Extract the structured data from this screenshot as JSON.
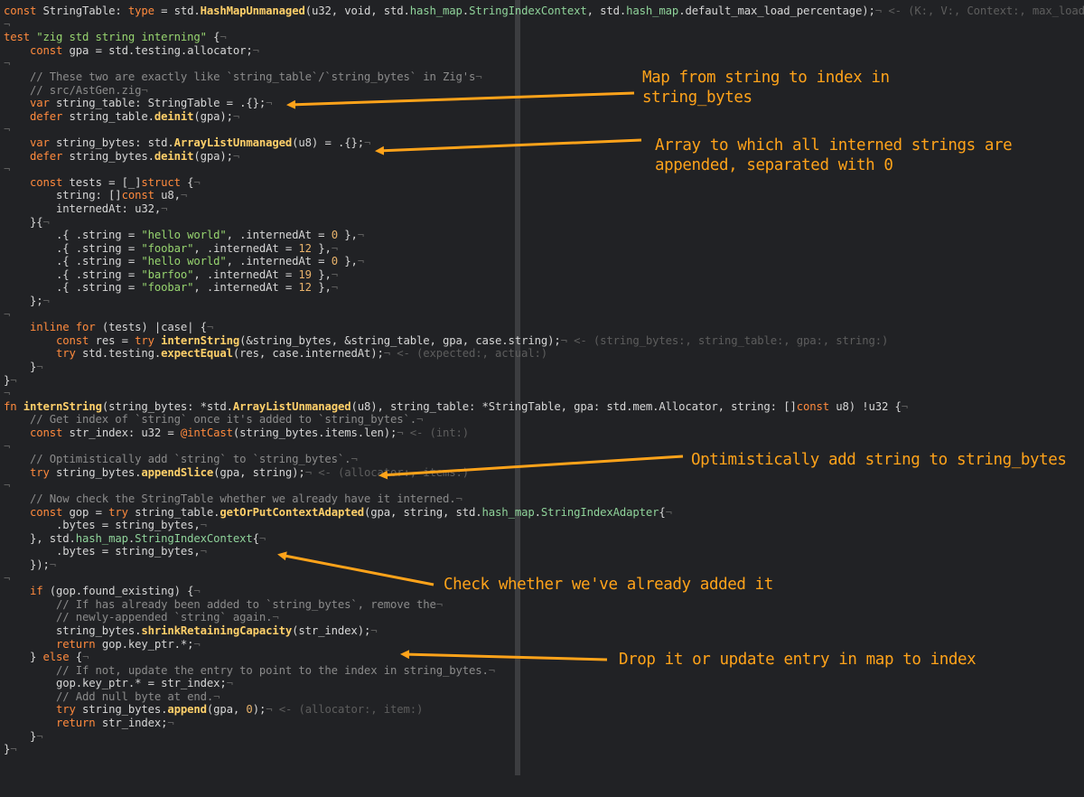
{
  "code_lines": [
    [
      [
        "kw",
        "const"
      ],
      [
        "p",
        " StringTable: "
      ],
      [
        "kw",
        "type"
      ],
      [
        "p",
        " = std."
      ],
      [
        "fn",
        "HashMapUnmanaged"
      ],
      [
        "p",
        "(u32, void, std."
      ],
      [
        "ty",
        "hash_map"
      ],
      [
        "p",
        "."
      ],
      [
        "ty",
        "StringIndexContext"
      ],
      [
        "p",
        ", std."
      ],
      [
        "ty",
        "hash_map"
      ],
      [
        "p",
        ".default_max_load_percentage);"
      ],
      [
        "pm",
        "¬"
      ],
      [
        "hint",
        " <- (K:, V:, Context:, max_load_p"
      ]
    ],
    [
      [
        "pm",
        "¬"
      ]
    ],
    [
      [
        "kw",
        "test"
      ],
      [
        "p",
        " "
      ],
      [
        "str",
        "\"zig std string interning\""
      ],
      [
        "p",
        " {"
      ],
      [
        "pm",
        "¬"
      ]
    ],
    [
      [
        "p",
        "    "
      ],
      [
        "kw",
        "const"
      ],
      [
        "p",
        " gpa = std.testing.allocator;"
      ],
      [
        "pm",
        "¬"
      ]
    ],
    [
      [
        "pm",
        "¬"
      ]
    ],
    [
      [
        "cm",
        "    // These two are exactly like `string_table`/`string_bytes` in Zig's"
      ],
      [
        "pm",
        "¬"
      ]
    ],
    [
      [
        "cm",
        "    // src/AstGen.zig"
      ],
      [
        "pm",
        "¬"
      ]
    ],
    [
      [
        "p",
        "    "
      ],
      [
        "kw",
        "var"
      ],
      [
        "p",
        " string_table: StringTable = .{};"
      ],
      [
        "pm",
        "¬"
      ]
    ],
    [
      [
        "p",
        "    "
      ],
      [
        "kw",
        "defer"
      ],
      [
        "p",
        " string_table."
      ],
      [
        "fn",
        "deinit"
      ],
      [
        "p",
        "(gpa);"
      ],
      [
        "pm",
        "¬"
      ]
    ],
    [
      [
        "pm",
        "¬"
      ]
    ],
    [
      [
        "p",
        "    "
      ],
      [
        "kw",
        "var"
      ],
      [
        "p",
        " string_bytes: std."
      ],
      [
        "fn",
        "ArrayListUnmanaged"
      ],
      [
        "p",
        "(u8) = .{};"
      ],
      [
        "pm",
        "¬"
      ]
    ],
    [
      [
        "p",
        "    "
      ],
      [
        "kw",
        "defer"
      ],
      [
        "p",
        " string_bytes."
      ],
      [
        "fn",
        "deinit"
      ],
      [
        "p",
        "(gpa);"
      ],
      [
        "pm",
        "¬"
      ]
    ],
    [
      [
        "pm",
        "¬"
      ]
    ],
    [
      [
        "p",
        "    "
      ],
      [
        "kw",
        "const"
      ],
      [
        "p",
        " tests = [_]"
      ],
      [
        "kw",
        "struct"
      ],
      [
        "p",
        " {"
      ],
      [
        "pm",
        "¬"
      ]
    ],
    [
      [
        "p",
        "        string: []"
      ],
      [
        "kw",
        "const"
      ],
      [
        "p",
        " u8,"
      ],
      [
        "pm",
        "¬"
      ]
    ],
    [
      [
        "p",
        "        internedAt: u32,"
      ],
      [
        "pm",
        "¬"
      ]
    ],
    [
      [
        "p",
        "    }{"
      ],
      [
        "pm",
        "¬"
      ]
    ],
    [
      [
        "p",
        "        .{ .string = "
      ],
      [
        "str",
        "\"hello world\""
      ],
      [
        "p",
        ", .internedAt = "
      ],
      [
        "num",
        "0"
      ],
      [
        "p",
        " },"
      ],
      [
        "pm",
        "¬"
      ]
    ],
    [
      [
        "p",
        "        .{ .string = "
      ],
      [
        "str",
        "\"foobar\""
      ],
      [
        "p",
        ", .internedAt = "
      ],
      [
        "num",
        "12"
      ],
      [
        "p",
        " },"
      ],
      [
        "pm",
        "¬"
      ]
    ],
    [
      [
        "p",
        "        .{ .string = "
      ],
      [
        "str",
        "\"hello world\""
      ],
      [
        "p",
        ", .internedAt = "
      ],
      [
        "num",
        "0"
      ],
      [
        "p",
        " },"
      ],
      [
        "pm",
        "¬"
      ]
    ],
    [
      [
        "p",
        "        .{ .string = "
      ],
      [
        "str",
        "\"barfoo\""
      ],
      [
        "p",
        ", .internedAt = "
      ],
      [
        "num",
        "19"
      ],
      [
        "p",
        " },"
      ],
      [
        "pm",
        "¬"
      ]
    ],
    [
      [
        "p",
        "        .{ .string = "
      ],
      [
        "str",
        "\"foobar\""
      ],
      [
        "p",
        ", .internedAt = "
      ],
      [
        "num",
        "12"
      ],
      [
        "p",
        " },"
      ],
      [
        "pm",
        "¬"
      ]
    ],
    [
      [
        "p",
        "    };"
      ],
      [
        "pm",
        "¬"
      ]
    ],
    [
      [
        "pm",
        "¬"
      ]
    ],
    [
      [
        "p",
        "    "
      ],
      [
        "kw",
        "inline for"
      ],
      [
        "p",
        " (tests) |case| {"
      ],
      [
        "pm",
        "¬"
      ]
    ],
    [
      [
        "p",
        "        "
      ],
      [
        "kw",
        "const"
      ],
      [
        "p",
        " res = "
      ],
      [
        "kw",
        "try"
      ],
      [
        "p",
        " "
      ],
      [
        "fn",
        "internString"
      ],
      [
        "p",
        "(&string_bytes, &string_table, gpa, case.string);"
      ],
      [
        "pm",
        "¬"
      ],
      [
        "hint",
        " <- (string_bytes:, string_table:, gpa:, string:)"
      ]
    ],
    [
      [
        "p",
        "        "
      ],
      [
        "kw",
        "try"
      ],
      [
        "p",
        " std.testing."
      ],
      [
        "fn",
        "expectEqual"
      ],
      [
        "p",
        "(res, case.internedAt);"
      ],
      [
        "pm",
        "¬"
      ],
      [
        "hint",
        " <- (expected:, actual:)"
      ]
    ],
    [
      [
        "p",
        "    }"
      ],
      [
        "pm",
        "¬"
      ]
    ],
    [
      [
        "p",
        "}"
      ],
      [
        "pm",
        "¬"
      ]
    ],
    [
      [
        "pm",
        "¬"
      ]
    ],
    [
      [
        "kw",
        "fn"
      ],
      [
        "p",
        " "
      ],
      [
        "fn",
        "internString"
      ],
      [
        "p",
        "(string_bytes: *std."
      ],
      [
        "fn",
        "ArrayListUnmanaged"
      ],
      [
        "p",
        "(u8), string_table: *StringTable, gpa: std.mem.Allocator, string: []"
      ],
      [
        "kw",
        "const"
      ],
      [
        "p",
        " u8) !u32 {"
      ],
      [
        "pm",
        "¬"
      ]
    ],
    [
      [
        "cm",
        "    // Get index of `string` once it's added to `string_bytes`."
      ],
      [
        "pm",
        "¬"
      ]
    ],
    [
      [
        "p",
        "    "
      ],
      [
        "kw",
        "const"
      ],
      [
        "p",
        " str_index: u32 = "
      ],
      [
        "kw",
        "@intCast"
      ],
      [
        "p",
        "(string_bytes.items.len);"
      ],
      [
        "pm",
        "¬"
      ],
      [
        "hint",
        " <- (int:)"
      ]
    ],
    [
      [
        "pm",
        "¬"
      ]
    ],
    [
      [
        "cm",
        "    // Optimistically add `string` to `string_bytes`."
      ],
      [
        "pm",
        "¬"
      ]
    ],
    [
      [
        "p",
        "    "
      ],
      [
        "kw",
        "try"
      ],
      [
        "p",
        " string_bytes."
      ],
      [
        "fn",
        "appendSlice"
      ],
      [
        "p",
        "(gpa, string);"
      ],
      [
        "pm",
        "¬"
      ],
      [
        "hint",
        " <- (allocator:, items:)"
      ]
    ],
    [
      [
        "pm",
        "¬"
      ]
    ],
    [
      [
        "cm",
        "    // Now check the StringTable whether we already have it interned."
      ],
      [
        "pm",
        "¬"
      ]
    ],
    [
      [
        "p",
        "    "
      ],
      [
        "kw",
        "const"
      ],
      [
        "p",
        " gop = "
      ],
      [
        "kw",
        "try"
      ],
      [
        "p",
        " string_table."
      ],
      [
        "fn",
        "getOrPutContextAdapted"
      ],
      [
        "p",
        "(gpa, string, std."
      ],
      [
        "ty",
        "hash_map"
      ],
      [
        "p",
        "."
      ],
      [
        "ty",
        "StringIndexAdapter"
      ],
      [
        "p",
        "{"
      ],
      [
        "pm",
        "¬"
      ]
    ],
    [
      [
        "p",
        "        .bytes = string_bytes,"
      ],
      [
        "pm",
        "¬"
      ]
    ],
    [
      [
        "p",
        "    }, std."
      ],
      [
        "ty",
        "hash_map"
      ],
      [
        "p",
        "."
      ],
      [
        "ty",
        "StringIndexContext"
      ],
      [
        "p",
        "{"
      ],
      [
        "pm",
        "¬"
      ]
    ],
    [
      [
        "p",
        "        .bytes = string_bytes,"
      ],
      [
        "pm",
        "¬"
      ]
    ],
    [
      [
        "p",
        "    });"
      ],
      [
        "pm",
        "¬"
      ]
    ],
    [
      [
        "pm",
        "¬"
      ]
    ],
    [
      [
        "p",
        "    "
      ],
      [
        "kw",
        "if"
      ],
      [
        "p",
        " (gop.found_existing) {"
      ],
      [
        "pm",
        "¬"
      ]
    ],
    [
      [
        "cm",
        "        // If has already been added to `string_bytes`, remove the"
      ],
      [
        "pm",
        "¬"
      ]
    ],
    [
      [
        "cm",
        "        // newly-appended `string` again."
      ],
      [
        "pm",
        "¬"
      ]
    ],
    [
      [
        "p",
        "        string_bytes."
      ],
      [
        "fn",
        "shrinkRetainingCapacity"
      ],
      [
        "p",
        "(str_index);"
      ],
      [
        "pm",
        "¬"
      ]
    ],
    [
      [
        "p",
        "        "
      ],
      [
        "kw",
        "return"
      ],
      [
        "p",
        " gop.key_ptr.*;"
      ],
      [
        "pm",
        "¬"
      ]
    ],
    [
      [
        "p",
        "    } "
      ],
      [
        "kw",
        "else"
      ],
      [
        "p",
        " {"
      ],
      [
        "pm",
        "¬"
      ]
    ],
    [
      [
        "cm",
        "        // If not, update the entry to point to the index in string_bytes."
      ],
      [
        "pm",
        "¬"
      ]
    ],
    [
      [
        "p",
        "        gop.key_ptr.* = str_index;"
      ],
      [
        "pm",
        "¬"
      ]
    ],
    [
      [
        "cm",
        "        // Add null byte at end."
      ],
      [
        "pm",
        "¬"
      ]
    ],
    [
      [
        "p",
        "        "
      ],
      [
        "kw",
        "try"
      ],
      [
        "p",
        " string_bytes."
      ],
      [
        "fn",
        "append"
      ],
      [
        "p",
        "(gpa, "
      ],
      [
        "num",
        "0"
      ],
      [
        "p",
        ");"
      ],
      [
        "pm",
        "¬"
      ],
      [
        "hint",
        " <- (allocator:, item:)"
      ]
    ],
    [
      [
        "p",
        "        "
      ],
      [
        "kw",
        "return"
      ],
      [
        "p",
        " str_index;"
      ],
      [
        "pm",
        "¬"
      ]
    ],
    [
      [
        "p",
        "    }"
      ],
      [
        "pm",
        "¬"
      ]
    ],
    [
      [
        "p",
        "}"
      ],
      [
        "pm",
        "¬"
      ]
    ]
  ],
  "annotations": {
    "string_table_note": "Map from string to index in\nstring_bytes",
    "string_bytes_note": "Array to which all interned strings are\nappended, separated with 0",
    "append_note": "Optimistically add string to string_bytes",
    "check_note": "Check whether we've already added it",
    "drop_note": "Drop it or update entry in map to index"
  },
  "colors": {
    "background": "#212225",
    "annotation": "#ffa31a",
    "keyword": "#ff8a3d",
    "function": "#ffd06a",
    "type": "#8fd39a",
    "string": "#97d46f",
    "comment": "#8b8b8b",
    "inlay_hint": "#5d5d5d"
  }
}
